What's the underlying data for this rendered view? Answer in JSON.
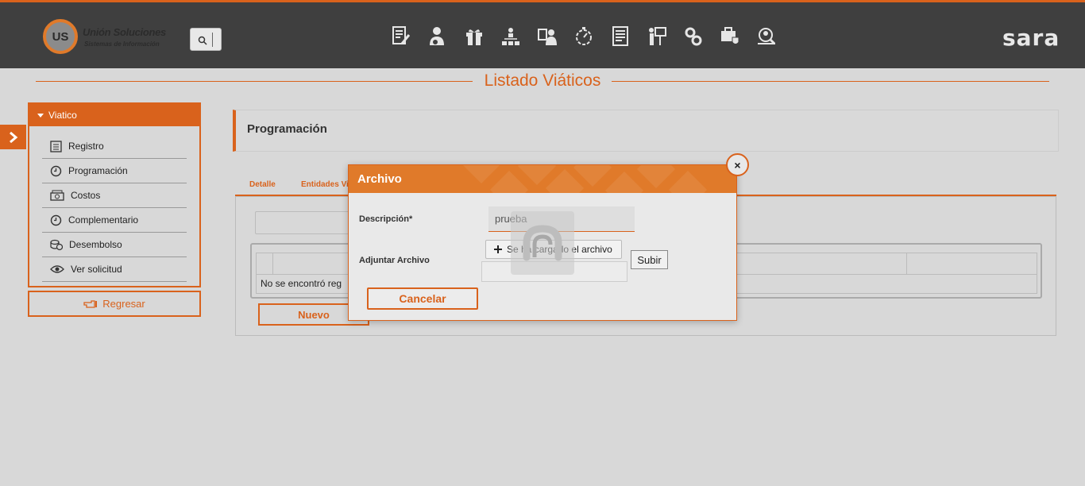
{
  "app": {
    "logo_mark": "US",
    "logo_name": "Unión Soluciones",
    "logo_sub": "Sistemas de Información",
    "brand": "sara",
    "module_icons": [
      "document-edit-icon",
      "user-config-icon",
      "gift-icon",
      "org-chart-icon",
      "user-id-icon",
      "timer-icon",
      "form-icon",
      "presentation-icon",
      "gears-icon",
      "medical-case-icon",
      "search-user-icon"
    ]
  },
  "page": {
    "title": "Listado Viáticos"
  },
  "sidebar": {
    "header": "Viatico",
    "items": [
      {
        "label": "Registro",
        "icon": "list-icon"
      },
      {
        "label": "Programación",
        "icon": "clock-icon"
      },
      {
        "label": "Costos",
        "icon": "money-icon"
      },
      {
        "label": "Complementario",
        "icon": "clock-icon"
      },
      {
        "label": "Desembolso",
        "icon": "coins-icon"
      },
      {
        "label": "Ver solicitud",
        "icon": "eye-icon"
      }
    ],
    "back_label": "Regresar"
  },
  "main": {
    "section_title": "Programación",
    "tabs": [
      "Detalle",
      "Entidades Vi"
    ],
    "grid_empty": "No se encontró reg",
    "new_button": "Nuevo"
  },
  "modal": {
    "title": "Archivo",
    "close": "×",
    "description_label": "Descripción*",
    "description_value": "prueba",
    "attach_label": "Adjuntar Archivo",
    "file_button": "Se ha cargado el archivo",
    "upload_button": "Subir",
    "cancel_button": "Cancelar"
  },
  "colors": {
    "accent": "#d9621c",
    "header_bg": "#3f3f3f",
    "page_bg": "#d8d8d8"
  }
}
